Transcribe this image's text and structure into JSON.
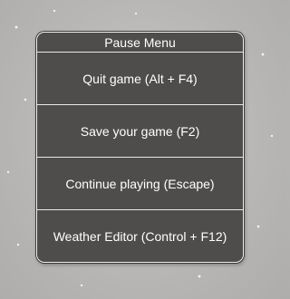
{
  "pause_menu": {
    "title": "Pause Menu",
    "items": [
      {
        "label": "Quit game (Alt + F4)"
      },
      {
        "label": "Save your game (F2)"
      },
      {
        "label": "Continue playing (Escape)"
      },
      {
        "label": "Weather Editor (Control + F12)"
      }
    ]
  },
  "colors": {
    "panel_background": "#4e4d4b",
    "panel_border": "#f2f2f2",
    "text": "#ffffff",
    "scene_background": "#bdbcba"
  }
}
